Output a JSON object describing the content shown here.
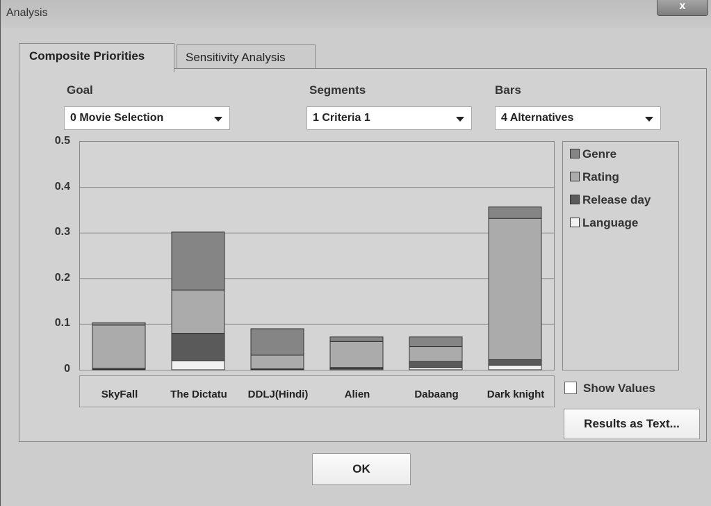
{
  "window": {
    "title": "Analysis",
    "close_label": "x"
  },
  "tabs": [
    {
      "label": "Composite Priorities",
      "active": true
    },
    {
      "label": "Sensitivity Analysis",
      "active": false
    }
  ],
  "controls": {
    "goal": {
      "label": "Goal",
      "value": "0 Movie Selection"
    },
    "segments": {
      "label": "Segments",
      "value": "1 Criteria 1"
    },
    "bars": {
      "label": "Bars",
      "value": "4 Alternatives"
    }
  },
  "show_values": {
    "label": "Show Values",
    "checked": false
  },
  "buttons": {
    "results_text": "Results as Text...",
    "ok": "OK"
  },
  "chart_data": {
    "type": "bar",
    "stacked": true,
    "categories": [
      "SkyFall",
      "The Dictatu",
      "DDLJ(Hindi)",
      "Alien",
      "Dabaang",
      "Dark  knight"
    ],
    "ylim": [
      0,
      0.5
    ],
    "yticks": [
      "0",
      "0.1",
      "0.2",
      "0.3",
      "0.4",
      "0.5"
    ],
    "grid": true,
    "legend_position": "right",
    "series": [
      {
        "name": "Language",
        "color": "#f2f2f2",
        "values": [
          0.001,
          0.02,
          0.001,
          0.002,
          0.005,
          0.01
        ]
      },
      {
        "name": "Release day",
        "color": "#5a5a5a",
        "values": [
          0.002,
          0.06,
          0.001,
          0.003,
          0.013,
          0.012
        ]
      },
      {
        "name": "Rating",
        "color": "#ababab",
        "values": [
          0.095,
          0.095,
          0.03,
          0.057,
          0.033,
          0.31
        ]
      },
      {
        "name": "Genre",
        "color": "#858585",
        "values": [
          0.005,
          0.127,
          0.058,
          0.01,
          0.021,
          0.025
        ]
      }
    ],
    "legend_order": [
      "Genre",
      "Rating",
      "Release day",
      "Language"
    ]
  }
}
